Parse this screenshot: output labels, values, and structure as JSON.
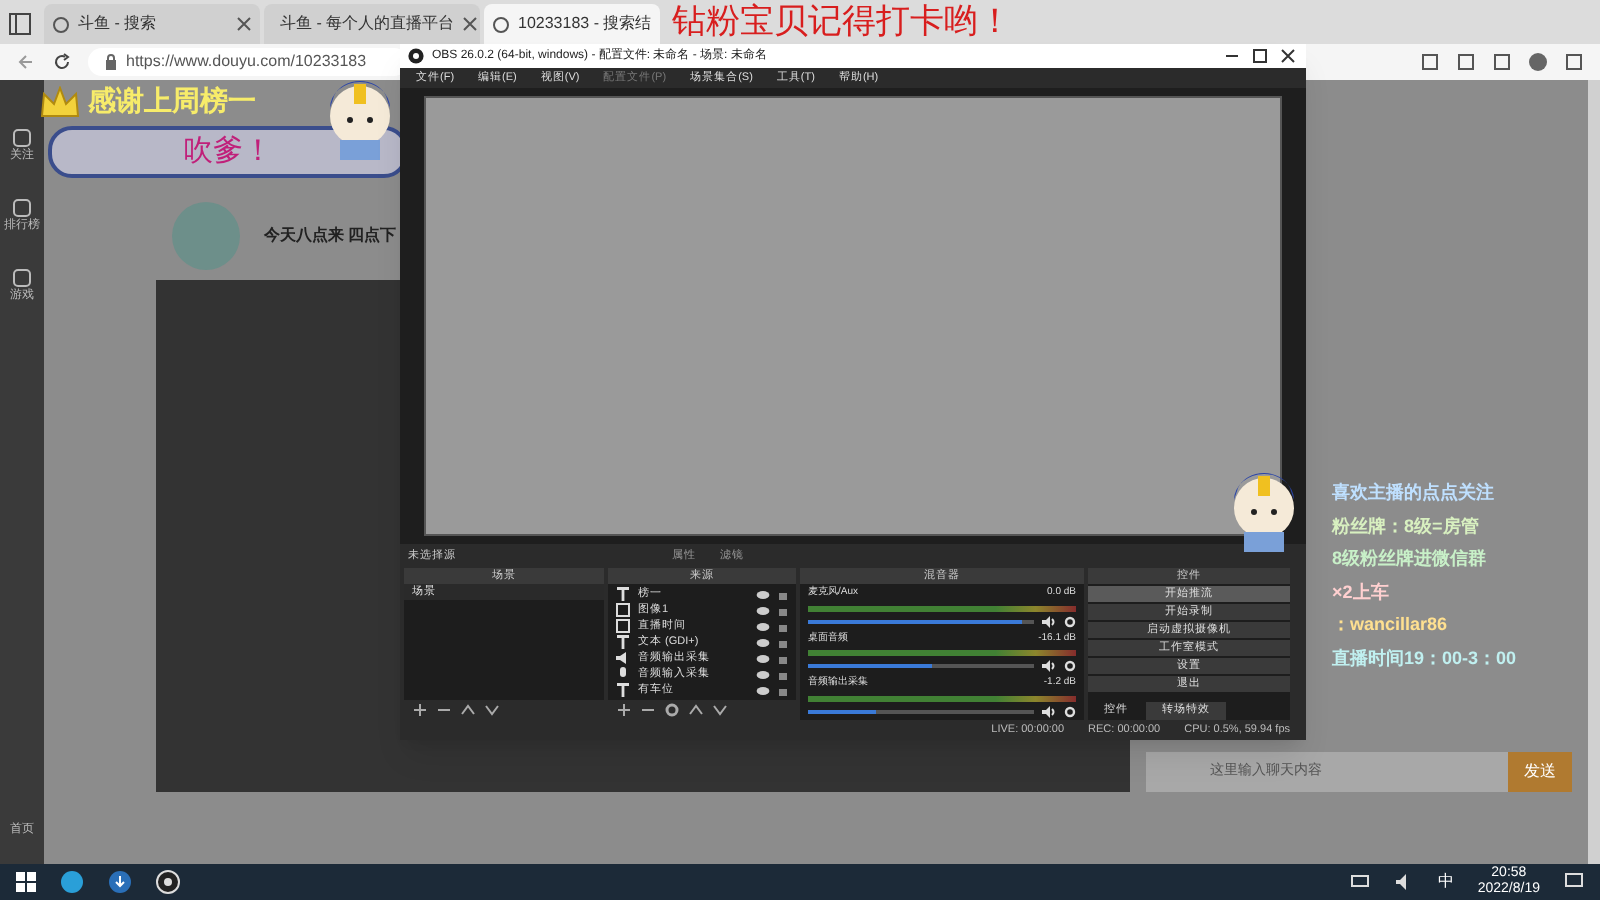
{
  "browser": {
    "tabs": [
      {
        "label": "斗鱼 - 搜索",
        "selected": false
      },
      {
        "label": "斗鱼 - 每个人的直播平台",
        "selected": false
      },
      {
        "label": "10233183 - 搜索结",
        "selected": true
      }
    ],
    "url": "https://www.douyu.com/10233183"
  },
  "sidebar": {
    "items": [
      "关注",
      "排行榜",
      "游戏"
    ],
    "bottom": "首页"
  },
  "stream_overlay": {
    "banner": "钻粉宝贝记得打卡哟！",
    "thanks": "感谢上周榜一",
    "thanks_name": "吹爹！",
    "info_lines": [
      {
        "text": "喜欢主播的点点关注",
        "color": "#bfe0ff"
      },
      {
        "text": "粉丝牌：8级=房管",
        "color": "#d8f0c0"
      },
      {
        "text": "8级粉丝牌进微信群",
        "color": "#c8f0c8"
      },
      {
        "text": "×2上车",
        "color": "#ffd0d0"
      },
      {
        "text": "：wancillar86",
        "color": "#ffe090"
      },
      {
        "text": "直播时间19：00-3：00",
        "color": "#c0f0f0"
      }
    ]
  },
  "room": {
    "title": "今天八点来 四点下",
    "chat_placeholder": "这里输入聊天内容",
    "send": "发送"
  },
  "obs": {
    "title": "OBS 26.0.2 (64-bit, windows) - 配置文件: 未命名 - 场景: 未命名",
    "menu": [
      {
        "label": "文件(F)",
        "disabled": false
      },
      {
        "label": "编辑(E)",
        "disabled": false
      },
      {
        "label": "视图(V)",
        "disabled": false
      },
      {
        "label": "配置文件(P)",
        "disabled": true
      },
      {
        "label": "场景集合(S)",
        "disabled": false
      },
      {
        "label": "工具(T)",
        "disabled": false
      },
      {
        "label": "帮助(H)",
        "disabled": false
      }
    ],
    "source_bar": {
      "label": "未选择源",
      "properties": "属性",
      "filters": "滤镜"
    },
    "scenes": {
      "title": "场景",
      "items": [
        {
          "label": "场景",
          "selected": false
        }
      ]
    },
    "sources": {
      "title": "来源",
      "items": [
        {
          "label": "榜一",
          "kind": "text"
        },
        {
          "label": "图像1",
          "kind": "image"
        },
        {
          "label": "直播时间",
          "kind": "image"
        },
        {
          "label": "文本 (GDI+)",
          "kind": "text"
        },
        {
          "label": "音频输出采集",
          "kind": "speaker"
        },
        {
          "label": "音频输入采集",
          "kind": "mic"
        },
        {
          "label": "有车位",
          "kind": "text"
        }
      ]
    },
    "mixer": {
      "title": "混音器",
      "channels": [
        {
          "name": "麦克风/Aux",
          "reading": "0.0 dB",
          "level": 0.95
        },
        {
          "name": "桌面音频",
          "reading": "-16.1 dB",
          "level": 0.55
        },
        {
          "name": "音频输出采集",
          "reading": "-1.2 dB",
          "level": 0.3
        }
      ]
    },
    "controls": {
      "title": "控件",
      "buttons": [
        {
          "label": "开始推流",
          "selected": true
        },
        {
          "label": "开始录制",
          "selected": false
        },
        {
          "label": "启动虚拟摄像机",
          "selected": false
        },
        {
          "label": "工作室模式",
          "selected": false
        },
        {
          "label": "设置",
          "selected": false
        },
        {
          "label": "退出",
          "selected": false
        }
      ],
      "tabs": [
        {
          "label": "控件",
          "selected": true
        },
        {
          "label": "转场特效",
          "selected": false
        }
      ]
    },
    "status_bar": {
      "live": "LIVE: 00:00:00",
      "rec": "REC: 00:00:00",
      "cpu": "CPU: 0.5%, 59.94 fps"
    }
  },
  "taskbar": {
    "ime": "中",
    "time": "20:58",
    "date": "2022/8/19"
  }
}
